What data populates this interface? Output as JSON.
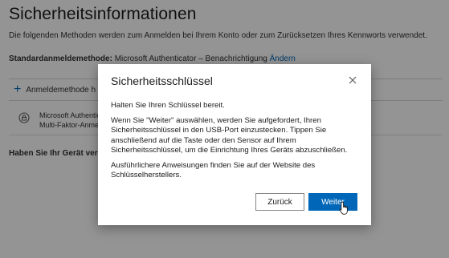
{
  "page": {
    "title": "Sicherheitsinformationen",
    "subtitle": "Die folgenden Methoden werden zum Anmelden bei Ihrem Konto oder zum Zurücksetzen Ihres Kennworts verwendet.",
    "default_method_label": "Standardanmeldemethode:",
    "default_method_value": "Microsoft Authenticator – Benachrichtigung",
    "default_method_change": "Ändern",
    "add_method_label": "Anmeldemethode h",
    "method_line1": "Microsoft Authentic",
    "method_line2": "Multi-Faktor-Anme",
    "lost_device_text": "Haben Sie Ihr Gerät verlo"
  },
  "dialog": {
    "title": "Sicherheitsschlüssel",
    "paragraph1": "Halten Sie Ihren Schlüssel bereit.",
    "paragraph2": "Wenn Sie \"Weiter\" auswählen, werden Sie aufgefordert, Ihren Sicherheitsschlüssel in den USB-Port einzustecken. Tippen Sie anschließend auf die Taste oder den Sensor auf Ihrem Sicherheitsschlüssel, um die Einrichtung Ihres Geräts abzuschließen.",
    "paragraph3": "Ausführlichere Anweisungen finden Sie auf der Website des Schlüsselherstellers.",
    "back_label": "Zurück",
    "next_label": "Weiter"
  },
  "icons": {
    "close": "close-icon",
    "plus": "plus-icon",
    "authenticator": "lock-icon",
    "cursor": "hand-pointer-icon"
  },
  "colors": {
    "accent": "#0067b8",
    "overlay": "rgba(0,0,0,0.42)"
  }
}
